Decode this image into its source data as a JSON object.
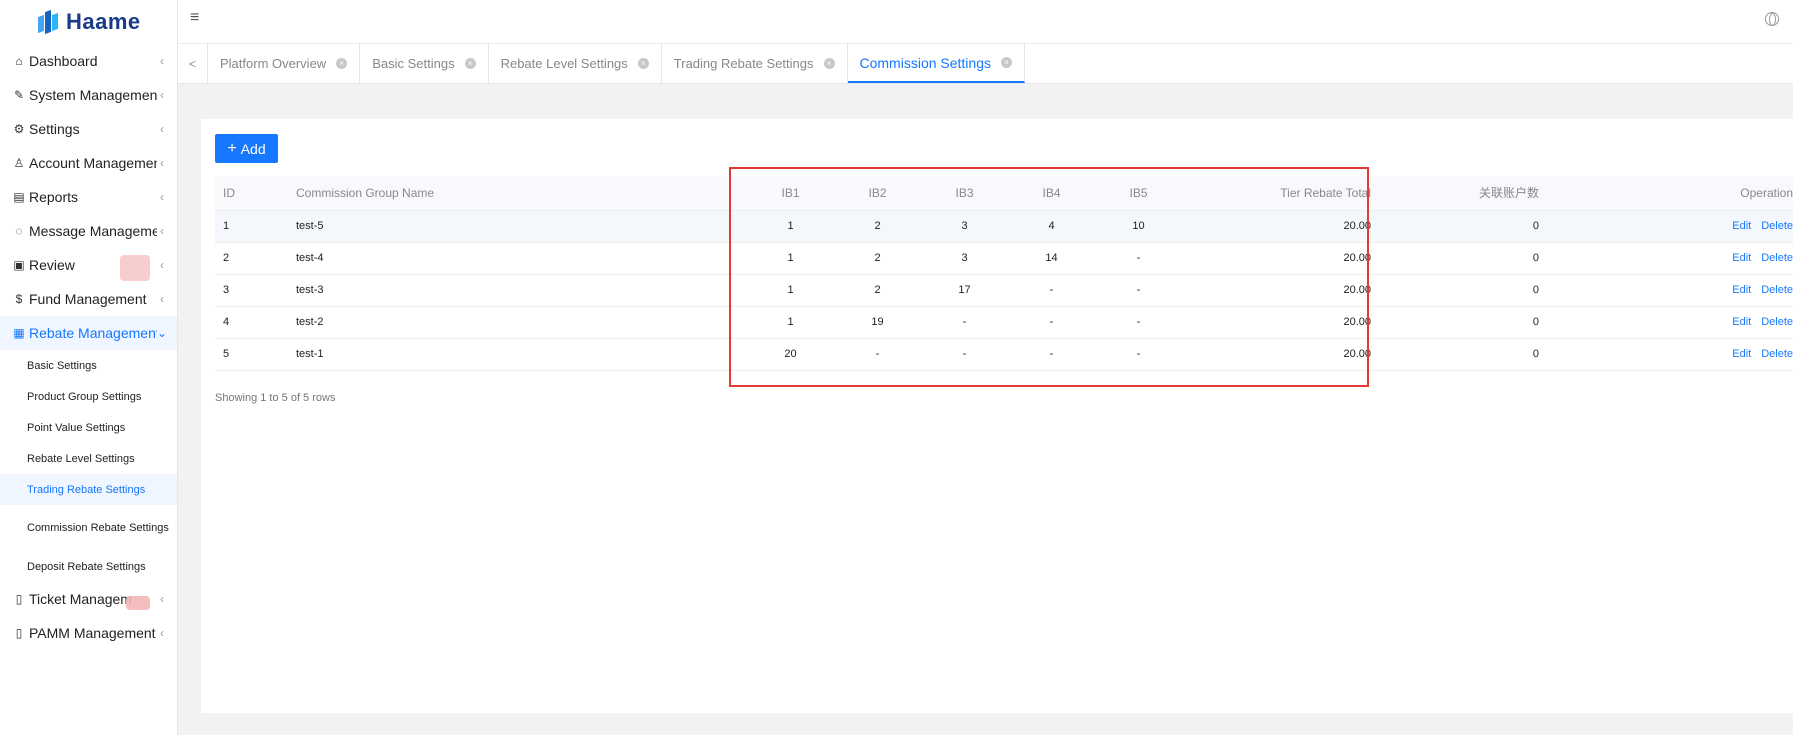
{
  "brand": {
    "name": "Haame"
  },
  "sidebar": {
    "items": [
      {
        "icon": "home-icon",
        "glyph": "⌂",
        "label": "Dashboard",
        "chevron": "‹"
      },
      {
        "icon": "wrench-icon",
        "glyph": "✎",
        "label": "System Management",
        "chevron": "‹"
      },
      {
        "icon": "gear-icon",
        "glyph": "⚙",
        "label": "Settings",
        "chevron": "‹"
      },
      {
        "icon": "user-icon",
        "glyph": "♙",
        "label": "Account Management",
        "chevron": "‹"
      },
      {
        "icon": "report-icon",
        "glyph": "▤",
        "label": "Reports",
        "chevron": "‹"
      },
      {
        "icon": "message-icon",
        "glyph": "◌",
        "label": "Message Management",
        "chevron": "‹"
      },
      {
        "icon": "review-icon",
        "glyph": "▣",
        "label": "Review",
        "chevron": "‹"
      },
      {
        "icon": "fund-icon",
        "glyph": "$",
        "label": "Fund Management",
        "chevron": "‹"
      },
      {
        "icon": "rebate-icon",
        "glyph": "▦",
        "label": "Rebate Management",
        "chevron": "⌄"
      },
      {
        "icon": "ticket-icon",
        "glyph": "▯",
        "label": "Ticket Managem",
        "chevron": "‹"
      },
      {
        "icon": "pamm-icon",
        "glyph": "▯",
        "label": "PAMM Management",
        "chevron": "‹"
      }
    ],
    "rebate_sub": [
      "Basic Settings",
      "Product Group Settings",
      "Point Value Settings",
      "Rebate Level Settings",
      "Trading Rebate Settings",
      "Commission Rebate Settings",
      "Deposit Rebate Settings"
    ]
  },
  "header": {
    "menu_glyph": "≡"
  },
  "tabs": [
    {
      "label": "Platform Overview"
    },
    {
      "label": "Basic Settings"
    },
    {
      "label": "Rebate Level Settings"
    },
    {
      "label": "Trading Rebate Settings"
    },
    {
      "label": "Commission Settings"
    }
  ],
  "tab_close_glyph": "×",
  "tab_prev_glyph": "<",
  "toolbar": {
    "add_glyph": "+",
    "add_label": "Add"
  },
  "table": {
    "columns": [
      "ID",
      "Commission Group Name",
      "IB1",
      "IB2",
      "IB3",
      "IB4",
      "IB5",
      "Tier Rebate Total",
      "关联账户数",
      "Operation"
    ],
    "rows": [
      {
        "id": "1",
        "name": "test-5",
        "ib1": "1",
        "ib2": "2",
        "ib3": "3",
        "ib4": "4",
        "ib5": "10",
        "total": "20.00",
        "assoc": "0"
      },
      {
        "id": "2",
        "name": "test-4",
        "ib1": "1",
        "ib2": "2",
        "ib3": "3",
        "ib4": "14",
        "ib5": "-",
        "total": "20.00",
        "assoc": "0"
      },
      {
        "id": "3",
        "name": "test-3",
        "ib1": "1",
        "ib2": "2",
        "ib3": "17",
        "ib4": "-",
        "ib5": "-",
        "total": "20.00",
        "assoc": "0"
      },
      {
        "id": "4",
        "name": "test-2",
        "ib1": "1",
        "ib2": "19",
        "ib3": "-",
        "ib4": "-",
        "ib5": "-",
        "total": "20.00",
        "assoc": "0"
      },
      {
        "id": "5",
        "name": "test-1",
        "ib1": "20",
        "ib2": "-",
        "ib3": "-",
        "ib4": "-",
        "ib5": "-",
        "total": "20.00",
        "assoc": "0"
      }
    ],
    "edit_label": "Edit",
    "delete_label": "Delete",
    "footer": "Showing 1 to 5 of 5 rows"
  },
  "colors": {
    "accent": "#1677ff",
    "highlight_box": "#e53935"
  }
}
